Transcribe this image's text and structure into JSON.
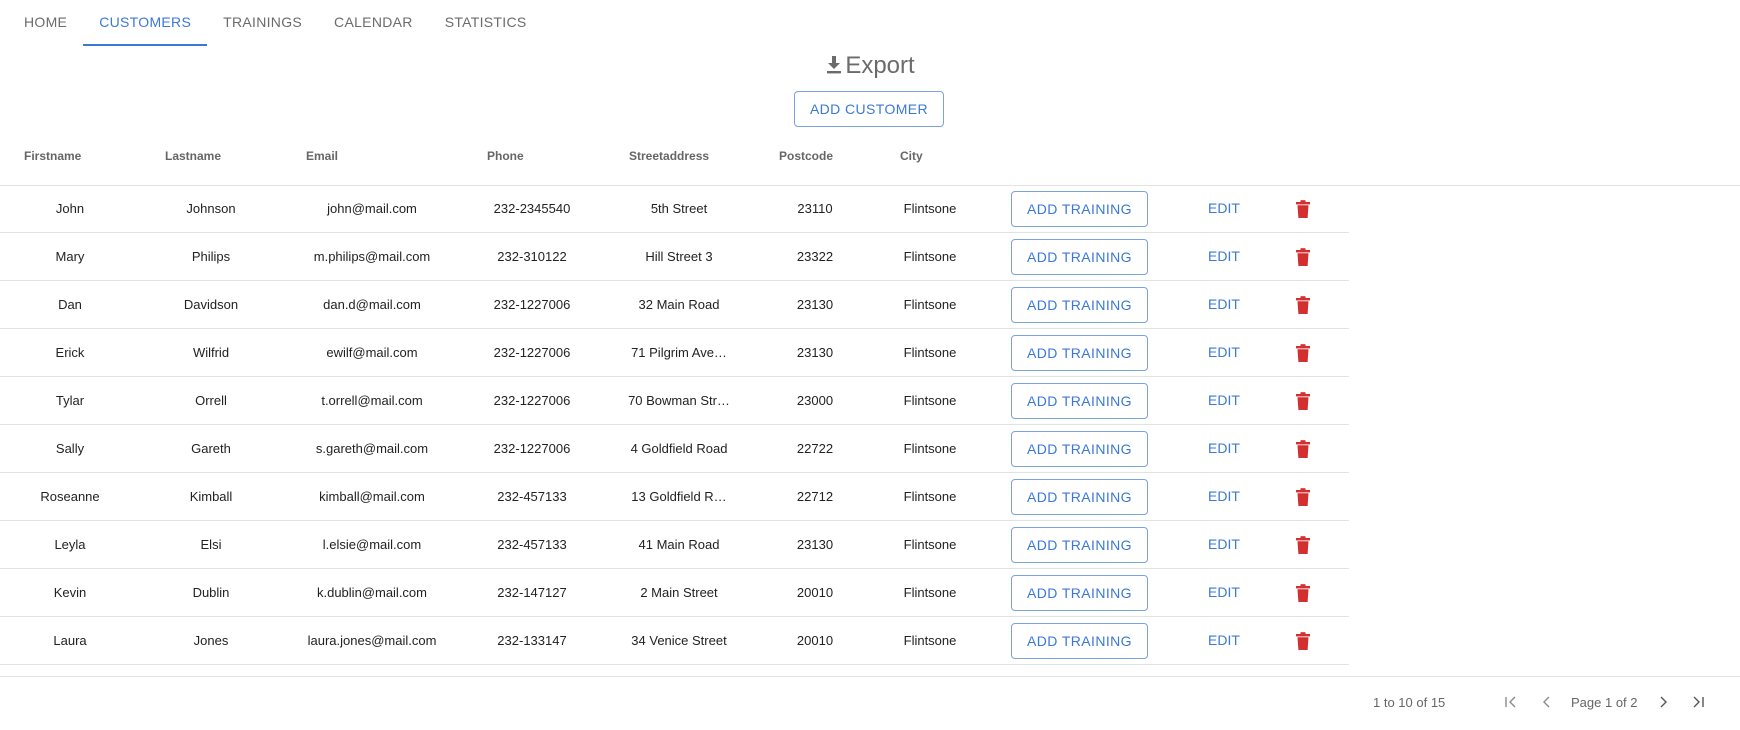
{
  "nav": {
    "tabs": [
      {
        "label": "HOME"
      },
      {
        "label": "CUSTOMERS"
      },
      {
        "label": "TRAININGS"
      },
      {
        "label": "CALENDAR"
      },
      {
        "label": "STATISTICS"
      }
    ],
    "active_tab": "CUSTOMERS"
  },
  "toolbar": {
    "export_label": "Export",
    "export_icon": "download-icon",
    "add_customer_label": "ADD CUSTOMER"
  },
  "table": {
    "columns": [
      "Firstname",
      "Lastname",
      "Email",
      "Phone",
      "Streetaddress",
      "Postcode",
      "City"
    ],
    "rows": [
      {
        "firstname": "John",
        "lastname": "Johnson",
        "email": "john@mail.com",
        "phone": "232-2345540",
        "street": "5th Street",
        "postcode": "23110",
        "city": "Flintsone"
      },
      {
        "firstname": "Mary",
        "lastname": "Philips",
        "email": "m.philips@mail.com",
        "phone": "232-310122",
        "street": "Hill Street 3",
        "postcode": "23322",
        "city": "Flintsone"
      },
      {
        "firstname": "Dan",
        "lastname": "Davidson",
        "email": "dan.d@mail.com",
        "phone": "232-1227006",
        "street": "32 Main Road",
        "postcode": "23130",
        "city": "Flintsone"
      },
      {
        "firstname": "Erick",
        "lastname": "Wilfrid",
        "email": "ewilf@mail.com",
        "phone": "232-1227006",
        "street": "71 Pilgrim Ave…",
        "postcode": "23130",
        "city": "Flintsone"
      },
      {
        "firstname": "Tylar",
        "lastname": "Orrell",
        "email": "t.orrell@mail.com",
        "phone": "232-1227006",
        "street": "70 Bowman Str…",
        "postcode": "23000",
        "city": "Flintsone"
      },
      {
        "firstname": "Sally",
        "lastname": "Gareth",
        "email": "s.gareth@mail.com",
        "phone": "232-1227006",
        "street": "4 Goldfield Road",
        "postcode": "22722",
        "city": "Flintsone"
      },
      {
        "firstname": "Roseanne",
        "lastname": "Kimball",
        "email": "kimball@mail.com",
        "phone": "232-457133",
        "street": "13 Goldfield R…",
        "postcode": "22712",
        "city": "Flintsone"
      },
      {
        "firstname": "Leyla",
        "lastname": "Elsi",
        "email": "l.elsie@mail.com",
        "phone": "232-457133",
        "street": "41 Main Road",
        "postcode": "23130",
        "city": "Flintsone"
      },
      {
        "firstname": "Kevin",
        "lastname": "Dublin",
        "email": "k.dublin@mail.com",
        "phone": "232-147127",
        "street": "2 Main Street",
        "postcode": "20010",
        "city": "Flintsone"
      },
      {
        "firstname": "Laura",
        "lastname": "Jones",
        "email": "laura.jones@mail.com",
        "phone": "232-133147",
        "street": "34 Venice Street",
        "postcode": "20010",
        "city": "Flintsone"
      }
    ],
    "row_actions": {
      "add_training_label": "ADD TRAINING",
      "edit_label": "EDIT",
      "delete_icon": "trash-icon"
    }
  },
  "pagination": {
    "summary": "1 to 10 of 15",
    "page_label": "Page 1 of 2",
    "icons": [
      "first-page-icon",
      "previous-page-icon",
      "next-page-icon",
      "last-page-icon"
    ]
  },
  "colors": {
    "accent": "#3b78d8",
    "danger": "#d32f2f",
    "muted_text": "#6b6b6b",
    "divider": "#e2e2e2"
  }
}
